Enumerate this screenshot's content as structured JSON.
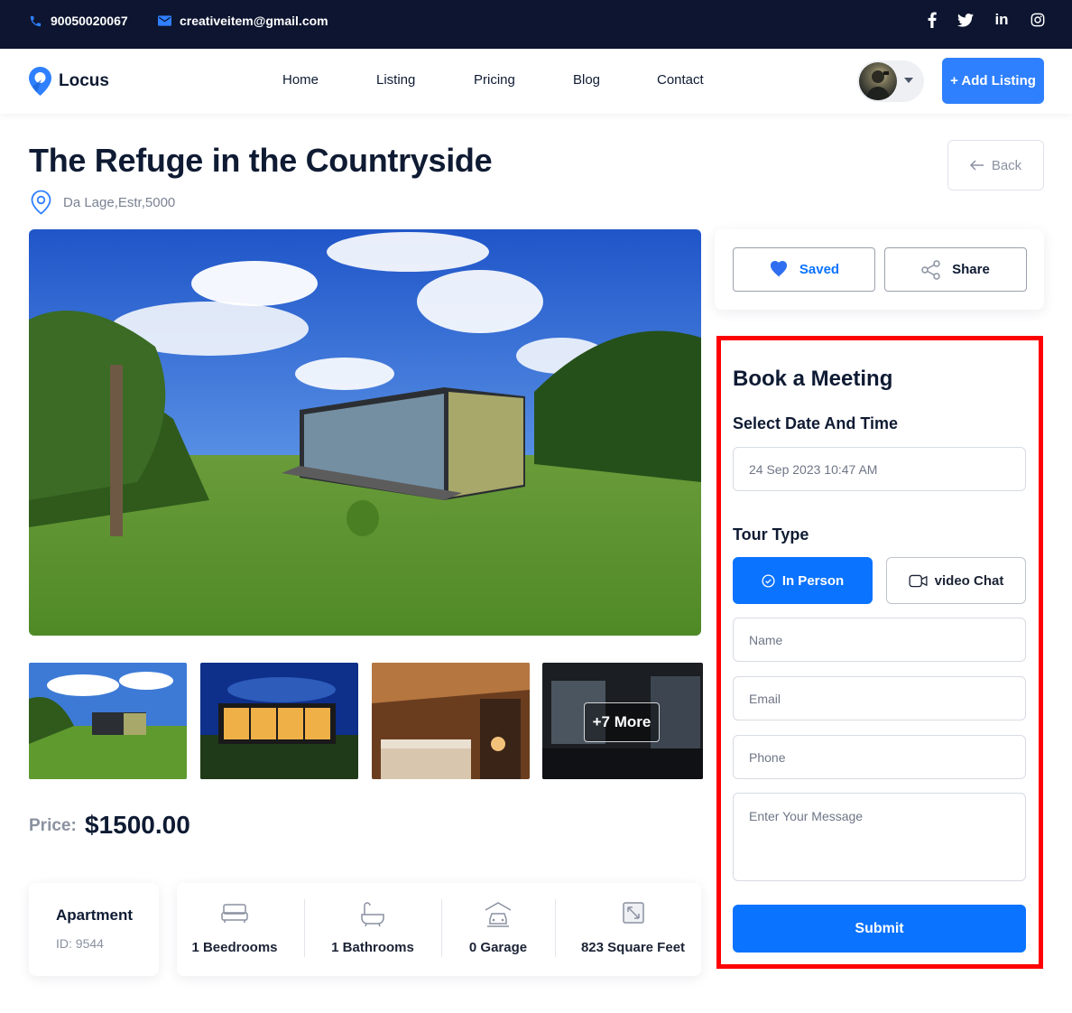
{
  "topbar": {
    "phone": "90050020067",
    "email": "creativeitem@gmail.com",
    "social_icons": [
      "facebook-icon",
      "twitter-icon",
      "linkedin-icon",
      "instagram-icon"
    ],
    "linkedin_text": "in"
  },
  "nav": {
    "logo_text": "Locus",
    "links": [
      "Home",
      "Listing",
      "Pricing",
      "Blog",
      "Contact"
    ],
    "add_listing": "+ Add Listing"
  },
  "listing": {
    "title": "The Refuge in the Countryside",
    "address": "Da Lage,Estr,5000",
    "back_label": "Back",
    "more_photos": "+7 More",
    "price_label": "Price:",
    "price_value": "$1500.00",
    "type": "Apartment",
    "id_text": "ID: 9544",
    "features": [
      {
        "icon": "bed-icon",
        "label": "1 Beedrooms"
      },
      {
        "icon": "bathtub-icon",
        "label": "1 Bathrooms"
      },
      {
        "icon": "garage-icon",
        "label": "0 Garage"
      },
      {
        "icon": "area-icon",
        "label": "823 Square Feet"
      }
    ]
  },
  "actions": {
    "saved_label": "Saved",
    "share_label": "Share"
  },
  "booking": {
    "title": "Book a Meeting",
    "date_heading": "Select Date And Time",
    "date_value": "24 Sep 2023 10:47 AM",
    "tour_heading": "Tour Type",
    "tour_in_person": "In Person",
    "tour_video": "video Chat",
    "name_placeholder": "Name",
    "email_placeholder": "Email",
    "phone_placeholder": "Phone",
    "message_placeholder": "Enter Your Message",
    "submit_label": "Submit"
  },
  "colors": {
    "accent": "#0a73ff",
    "topbar_bg": "#0d1530",
    "highlight_border": "#ff0000"
  }
}
